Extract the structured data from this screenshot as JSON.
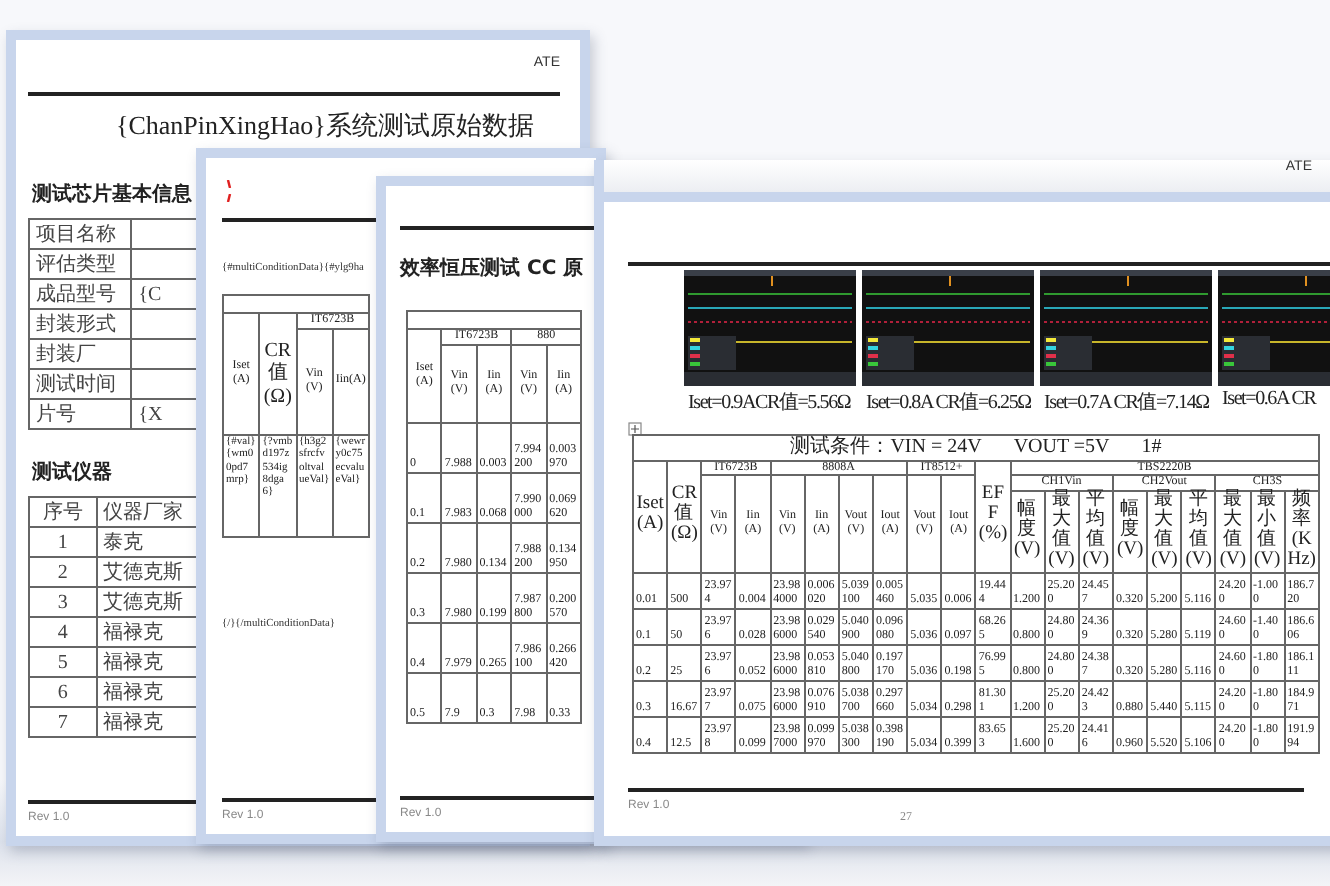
{
  "doc_page_1": {
    "header": "ATE",
    "title": "{ChanPinXingHao}系统测试原始数据",
    "info_heading": "测试芯片基本信息",
    "info_rows": [
      {
        "label": "项目名称"
      },
      {
        "label": "评估类型"
      },
      {
        "label": "成品型号",
        "value": "{C"
      },
      {
        "label": "封装形式"
      },
      {
        "label": "封装厂"
      },
      {
        "label": "测试时间"
      },
      {
        "label": "片号",
        "value": "{X"
      }
    ],
    "instrument_heading": "测试仪器",
    "instrument_columns": [
      "序号",
      "仪器厂家"
    ],
    "instrument_rows": [
      [
        "1",
        "泰克"
      ],
      [
        "2",
        "艾德克斯"
      ],
      [
        "3",
        "艾德克斯"
      ],
      [
        "4",
        "福禄克"
      ],
      [
        "5",
        "福禄克"
      ],
      [
        "6",
        "福禄克"
      ],
      [
        "7",
        "福禄克"
      ]
    ],
    "footer": "Rev 1.0"
  },
  "doc_page_2": {
    "template_line": "{#multiConditionData}{#ylg9ha",
    "table": {
      "group": "IT6723B",
      "columns": [
        "Iset(A)",
        "CR值(Ω)",
        "Vin(V)",
        "Iin(A)"
      ],
      "row": [
        "{#val}{wm00pd7mrp}",
        "{?vmbd197z534ig8dga6}",
        "{h3g2sfrcfvoltvalueVal}",
        "{wewry0c75ecvalueVal}"
      ]
    },
    "end_line": "{/}{/multiConditionData}",
    "footer": "Rev 1.0"
  },
  "doc_page_3": {
    "title": "效率恒压测试 CC 原",
    "table": {
      "first_column": "Iset(A)",
      "groups": [
        {
          "label": "IT6723B",
          "columns": [
            "Vin(V)",
            "Iin(A)"
          ]
        },
        {
          "label": "880",
          "columns": [
            "Vin(V)",
            "Iin(A)"
          ]
        }
      ],
      "rows": [
        [
          "0",
          "7.988",
          "0.003",
          "7.994200",
          "0.003970"
        ],
        [
          "0.1",
          "7.983",
          "0.068",
          "7.990000",
          "0.069620"
        ],
        [
          "0.2",
          "7.980",
          "0.134",
          "7.988200",
          "0.134950"
        ],
        [
          "0.3",
          "7.980",
          "0.199",
          "7.987800",
          "0.200570"
        ],
        [
          "0.4",
          "7.979",
          "0.265",
          "7.986100",
          "0.266420"
        ],
        [
          "0.5",
          "7.9",
          "0.3",
          "7.98",
          "0.33"
        ]
      ]
    },
    "footer": "Rev 1.0"
  },
  "doc_page_4": {
    "header": "ATE",
    "waveforms": [
      {
        "caption": "Iset=0.9ACR值=5.56Ω"
      },
      {
        "caption": "Iset=0.8A CR值=6.25Ω"
      },
      {
        "caption": "Iset=0.7A CR值=7.14Ω"
      },
      {
        "caption": "Iset=0.6A CR"
      }
    ],
    "table": {
      "condition": "测试条件：VIN = 24V",
      "vout": "VOUT =5V",
      "sample": "1#",
      "header_groups": [
        {
          "label": "Iset(A)"
        },
        {
          "label": "CR值(Ω)"
        },
        {
          "label": "IT6723B",
          "fields": [
            "Vin(V)",
            "Iin(A)"
          ]
        },
        {
          "label": "8808A",
          "fields": [
            "Vin(V)",
            "Iin(A)",
            "Vout(V)",
            "Iout(A)"
          ]
        },
        {
          "label": "IT8512+",
          "fields": [
            "Vout(V)",
            "Iout(A)"
          ]
        },
        {
          "label": "EFF(%)"
        },
        {
          "label": "TBS2220B",
          "subgroups": [
            {
              "label": "CH1Vin",
              "fields": [
                "幅度(V)",
                "最大值(V)",
                "平均值(V)"
              ]
            },
            {
              "label": "CH2Vout",
              "fields": [
                "幅度(V)",
                "最大值(V)",
                "平均值(V)"
              ]
            },
            {
              "label": "CH3S",
              "fields": [
                "最大值(V)",
                "最小值(V)",
                "频率(KHz)"
              ]
            }
          ]
        }
      ],
      "rows": [
        [
          "0.01",
          "500",
          "23.974",
          "0.004",
          "23.984000",
          "0.006020",
          "5.039100",
          "0.005460",
          "5.035",
          "0.006",
          "19.444",
          "1.200",
          "25.200",
          "24.457",
          "0.320",
          "5.200",
          "5.116",
          "24.200",
          "-1.000",
          "186.720"
        ],
        [
          "0.1",
          "50",
          "23.976",
          "0.028",
          "23.986000",
          "0.029540",
          "5.040900",
          "0.096080",
          "5.036",
          "0.097",
          "68.265",
          "0.800",
          "24.800",
          "24.369",
          "0.320",
          "5.280",
          "5.119",
          "24.600",
          "-1.400",
          "186.606"
        ],
        [
          "0.2",
          "25",
          "23.976",
          "0.052",
          "23.986000",
          "0.053810",
          "5.040800",
          "0.197170",
          "5.036",
          "0.198",
          "76.995",
          "0.800",
          "24.800",
          "24.387",
          "0.320",
          "5.280",
          "5.116",
          "24.600",
          "-1.800",
          "186.111"
        ],
        [
          "0.3",
          "16.67",
          "23.977",
          "0.075",
          "23.986000",
          "0.076910",
          "5.038700",
          "0.297660",
          "5.034",
          "0.298",
          "81.301",
          "1.200",
          "25.200",
          "24.423",
          "0.880",
          "5.440",
          "5.115",
          "24.200",
          "-1.800",
          "184.971"
        ],
        [
          "0.4",
          "12.5",
          "23.978",
          "0.099",
          "23.987000",
          "0.099970",
          "5.038300",
          "0.398190",
          "5.034",
          "0.399",
          "83.653",
          "1.600",
          "25.200",
          "24.416",
          "0.960",
          "5.520",
          "5.106",
          "24.200",
          "-1.800",
          "191.994"
        ]
      ]
    },
    "footer": "Rev 1.0",
    "page_number": "27"
  }
}
